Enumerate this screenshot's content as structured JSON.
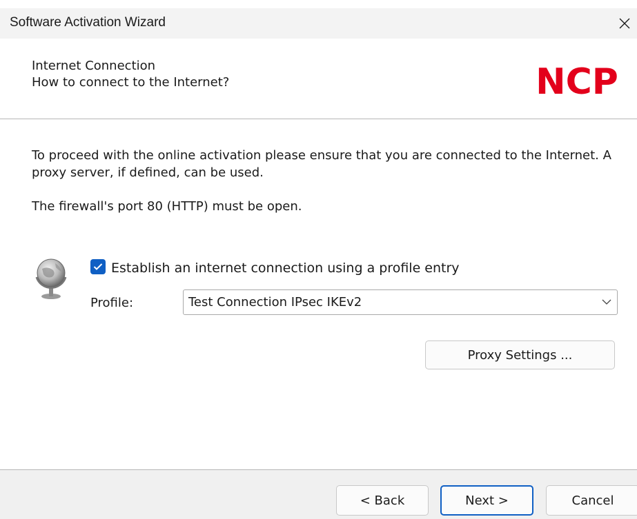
{
  "window": {
    "title": "Software Activation Wizard"
  },
  "header": {
    "title": "Internet Connection",
    "subtitle": "How to connect to the Internet?",
    "logo_text": "NCP",
    "logo_color": "#e3001b"
  },
  "body": {
    "paragraph1": "To proceed with the online activation please ensure that you are connected to the Internet. A proxy server, if defined, can be used.",
    "paragraph2": "The firewall's port 80 (HTTP) must be open."
  },
  "connection": {
    "icon": "globe-icon",
    "checkbox_checked": true,
    "checkbox_label": "Establish an internet connection using a profile entry",
    "profile_label": "Profile:",
    "profile_value": "Test Connection IPsec IKEv2"
  },
  "buttons": {
    "proxy_settings": "Proxy Settings ...",
    "back": "< Back",
    "next": "Next >",
    "cancel": "Cancel"
  },
  "colors": {
    "accent": "#0f5fc4",
    "footer_bg": "#f0f0f0",
    "titlebar_bg": "#f3f3f3"
  }
}
